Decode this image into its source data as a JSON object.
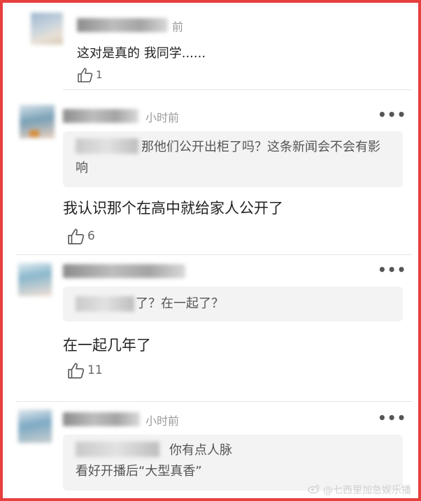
{
  "comments": [
    {
      "time": "前",
      "text": "这对是真的 我同学......",
      "likes": "1"
    },
    {
      "time": "小时前",
      "quote": "那他们公开出柜了吗？这条新闻会不会有影响",
      "text": "我认识那个在高中就给家人公开了",
      "likes": "6"
    },
    {
      "quote": "了？在一起了？",
      "text": "在一起几年了",
      "likes": "11"
    },
    {
      "time": "小时前",
      "quote_line1": "你有点人脉",
      "quote_line2": "看好开播后“大型真香”"
    }
  ],
  "more_label": "•••",
  "watermark": "@七西里加急娱乐播",
  "accent_border_color": "#e8403f"
}
